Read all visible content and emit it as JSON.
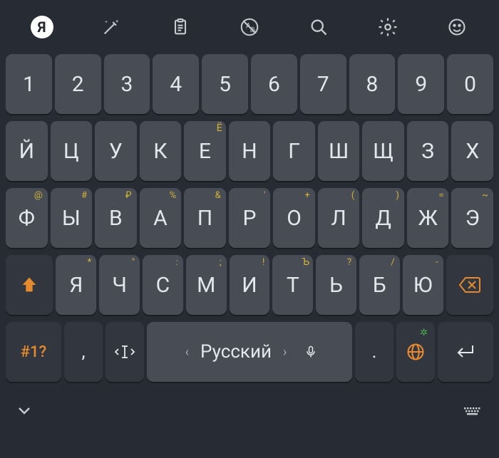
{
  "toolbar": {
    "yandex": "Я"
  },
  "rows": {
    "numbers": [
      "1",
      "2",
      "3",
      "4",
      "5",
      "6",
      "7",
      "8",
      "9",
      "0"
    ],
    "r1": [
      {
        "c": "Й"
      },
      {
        "c": "Ц"
      },
      {
        "c": "У"
      },
      {
        "c": "К"
      },
      {
        "c": "Е",
        "h": "Ё"
      },
      {
        "c": "Н"
      },
      {
        "c": "Г"
      },
      {
        "c": "Ш"
      },
      {
        "c": "Щ"
      },
      {
        "c": "З"
      },
      {
        "c": "Х"
      }
    ],
    "r2": [
      {
        "c": "Ф",
        "h": "@"
      },
      {
        "c": "Ы",
        "h": "#"
      },
      {
        "c": "В",
        "h": "₽"
      },
      {
        "c": "А",
        "h": "%"
      },
      {
        "c": "П",
        "h": "&"
      },
      {
        "c": "Р",
        "h": "'"
      },
      {
        "c": "О",
        "h": "+"
      },
      {
        "c": "Л",
        "h": "("
      },
      {
        "c": "Д",
        "h": ")"
      },
      {
        "c": "Ж",
        "h": "="
      },
      {
        "c": "Э",
        "h": "~"
      }
    ],
    "r3": [
      {
        "c": "Я",
        "h": "*"
      },
      {
        "c": "Ч",
        "h": "\""
      },
      {
        "c": "С",
        "h": ":"
      },
      {
        "c": "М",
        "h": ";"
      },
      {
        "c": "И",
        "h": "!"
      },
      {
        "c": "Т",
        "h": "Ъ"
      },
      {
        "c": "Ь",
        "h": "?"
      },
      {
        "c": "Б",
        "h": "/"
      },
      {
        "c": "Ю",
        "h": "-"
      }
    ]
  },
  "bottom": {
    "sym": "#1?",
    "comma": ",",
    "language": "Русский",
    "period": "."
  }
}
